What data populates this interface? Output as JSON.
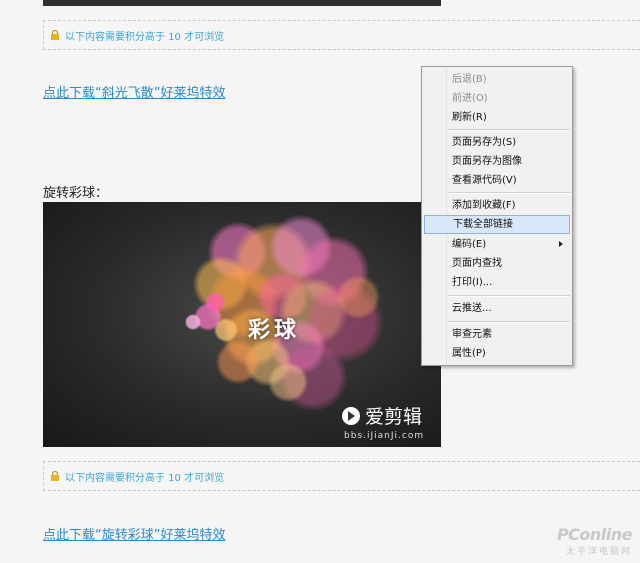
{
  "section1": {
    "locked_notice": "以下内容需要积分高于 10 才可浏览",
    "download_link": "点此下载“斜光飞散”好莱坞特效"
  },
  "section2": {
    "caption": "旋转彩球：",
    "image": {
      "title": "彩球",
      "brand_name": "爱剪辑",
      "brand_url": "bbs.iJianJi.com"
    },
    "locked_notice": "以下内容需要积分高于 10 才可浏览",
    "download_link": "点此下载“旋转彩球”好莱坞特效"
  },
  "watermark": {
    "main": "PConline",
    "sub": "太平洋电脑网"
  },
  "context_menu": {
    "items": [
      {
        "label": "后退(B)",
        "enabled": false
      },
      {
        "label": "前进(O)",
        "enabled": false
      },
      {
        "label": "刷新(R)",
        "enabled": true
      },
      {
        "label": "页面另存为(S)",
        "enabled": true
      },
      {
        "label": "页面另存为图像",
        "enabled": true
      },
      {
        "label": "查看源代码(V)",
        "enabled": true
      },
      {
        "label": "添加到收藏(F)",
        "enabled": true
      },
      {
        "label": "下载全部链接",
        "enabled": true,
        "highlighted": true
      },
      {
        "label": "编码(E)",
        "enabled": true,
        "submenu": true
      },
      {
        "label": "页面内查找",
        "enabled": true
      },
      {
        "label": "打印(I)...",
        "enabled": true
      },
      {
        "label": "云推送...",
        "enabled": true
      },
      {
        "label": "审查元素",
        "enabled": true
      },
      {
        "label": "属性(P)",
        "enabled": true
      }
    ]
  },
  "colors": {
    "link": "#2d89c9",
    "locked_text": "#3ba7d6",
    "menu_highlight": "#d8e8f8"
  }
}
